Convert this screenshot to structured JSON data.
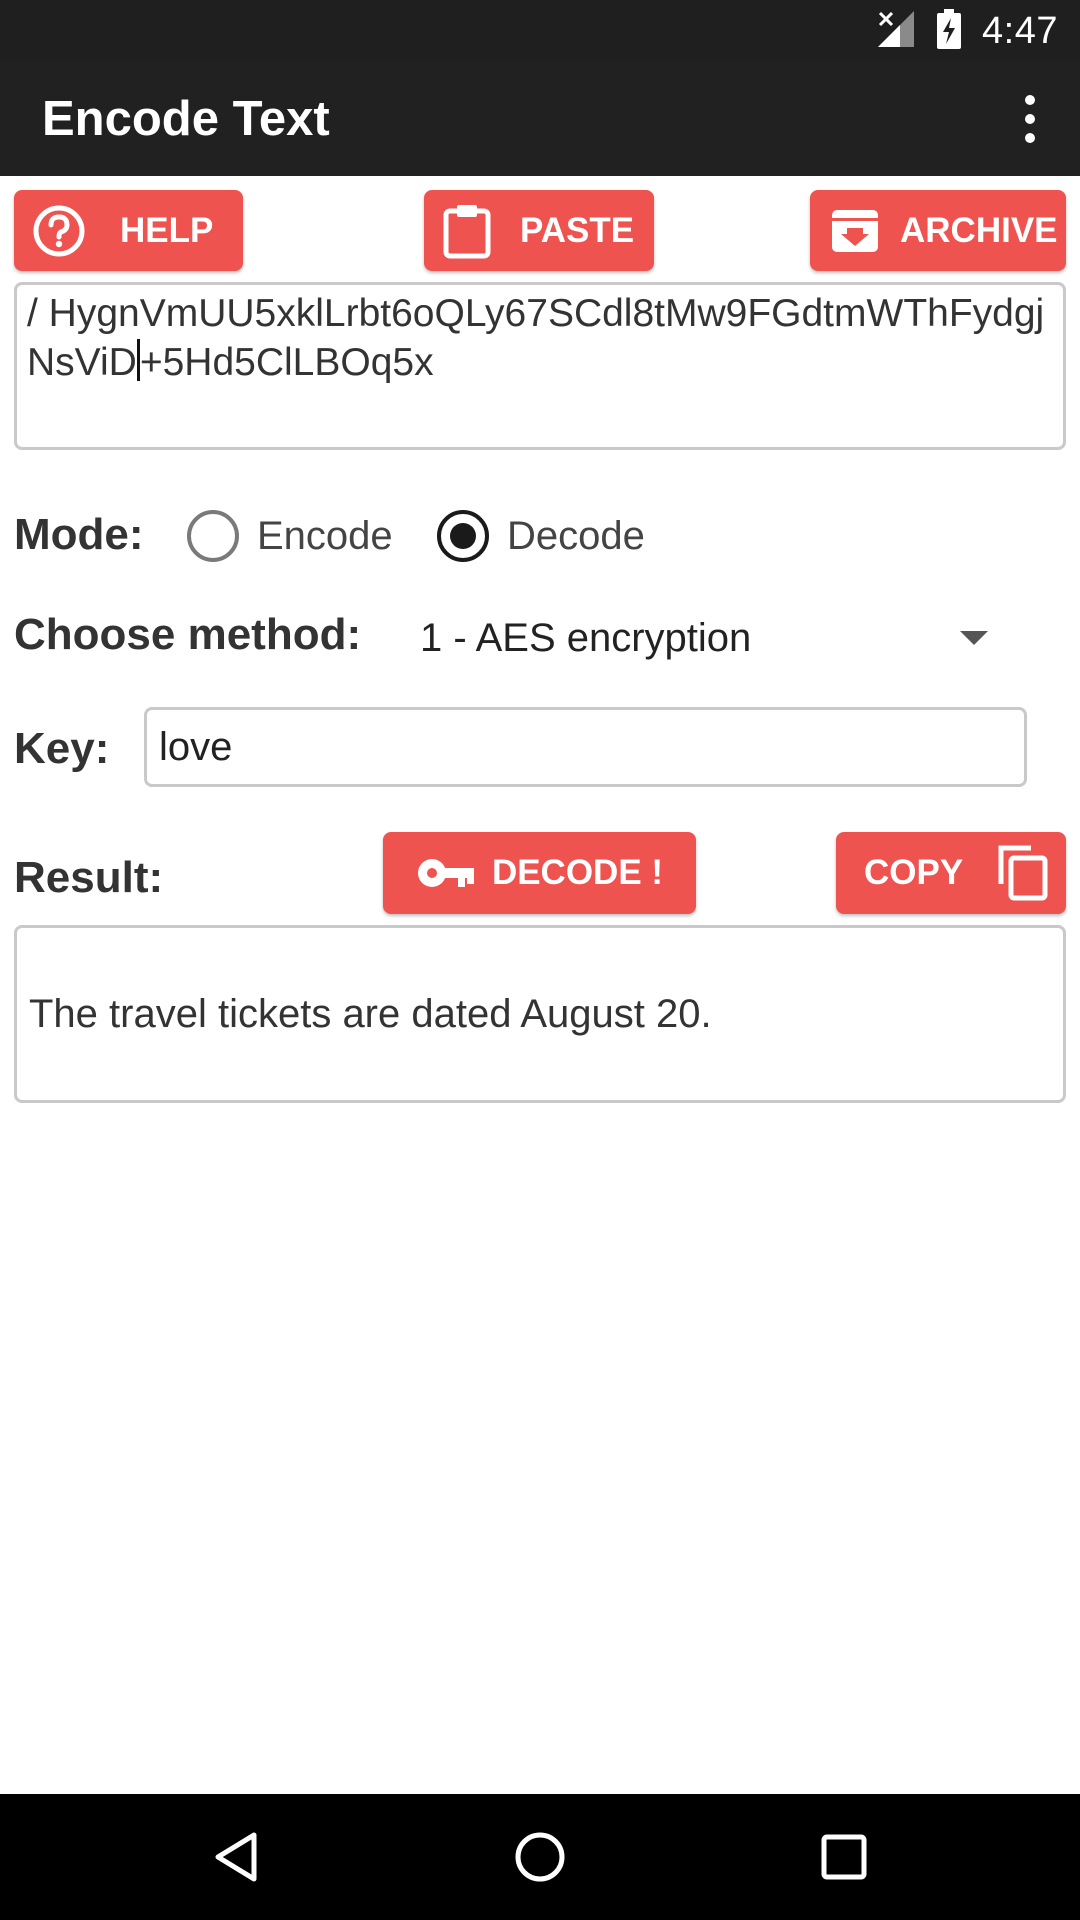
{
  "status_bar": {
    "time": "4:47"
  },
  "app_bar": {
    "title": "Encode Text",
    "overflow_icon": "more-vert-icon"
  },
  "toolbar": {
    "help_label": "HELP",
    "paste_label": "PASTE",
    "archive_label": "ARCHIVE"
  },
  "input": {
    "text_before_caret": "/ HygnVmUU5xklLrbt6oQLy67SCdl8tMw9FGdtmWThFydgjNsViD",
    "text_after_caret": "+5Hd5ClLBOq5x"
  },
  "mode": {
    "label": "Mode:",
    "options": [
      {
        "label": "Encode",
        "selected": false
      },
      {
        "label": "Decode",
        "selected": true
      }
    ]
  },
  "method": {
    "label": "Choose method:",
    "selected": "1 - AES encryption"
  },
  "key": {
    "label": "Key:",
    "value": "love"
  },
  "result": {
    "label": "Result:",
    "decode_label": "DECODE !",
    "copy_label": "COPY",
    "text": "The travel tickets are dated August 20."
  },
  "colors": {
    "accent": "#ef5350",
    "app_bar": "#212121",
    "status_bar": "#1f1f1f"
  }
}
